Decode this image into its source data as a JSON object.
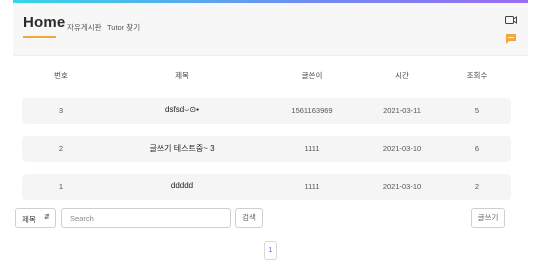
{
  "header": {
    "logo": "Home",
    "nav": [
      "자유게시판",
      "Tutor 찾기"
    ],
    "accent_color": "#f0a83c",
    "icons": [
      "video-icon",
      "chat-icon"
    ]
  },
  "table": {
    "columns": [
      "번호",
      "제목",
      "글쓴이",
      "시간",
      "조회수"
    ],
    "rows": [
      {
        "num": "3",
        "title": "dsfsd⌣⊙▪",
        "author": "1561163969",
        "time": "2021-03-11",
        "views": "5"
      },
      {
        "num": "2",
        "title": "글쓰기 테스트중~  3",
        "author": "1111",
        "time": "2021-03-10",
        "views": "6"
      },
      {
        "num": "1",
        "title": "ddddd",
        "author": "1111",
        "time": "2021-03-10",
        "views": "2"
      }
    ]
  },
  "search": {
    "select_value": "제목",
    "placeholder": "Search",
    "search_button": "검색",
    "write_button": "글쓰기"
  },
  "pagination": {
    "current": "1"
  }
}
